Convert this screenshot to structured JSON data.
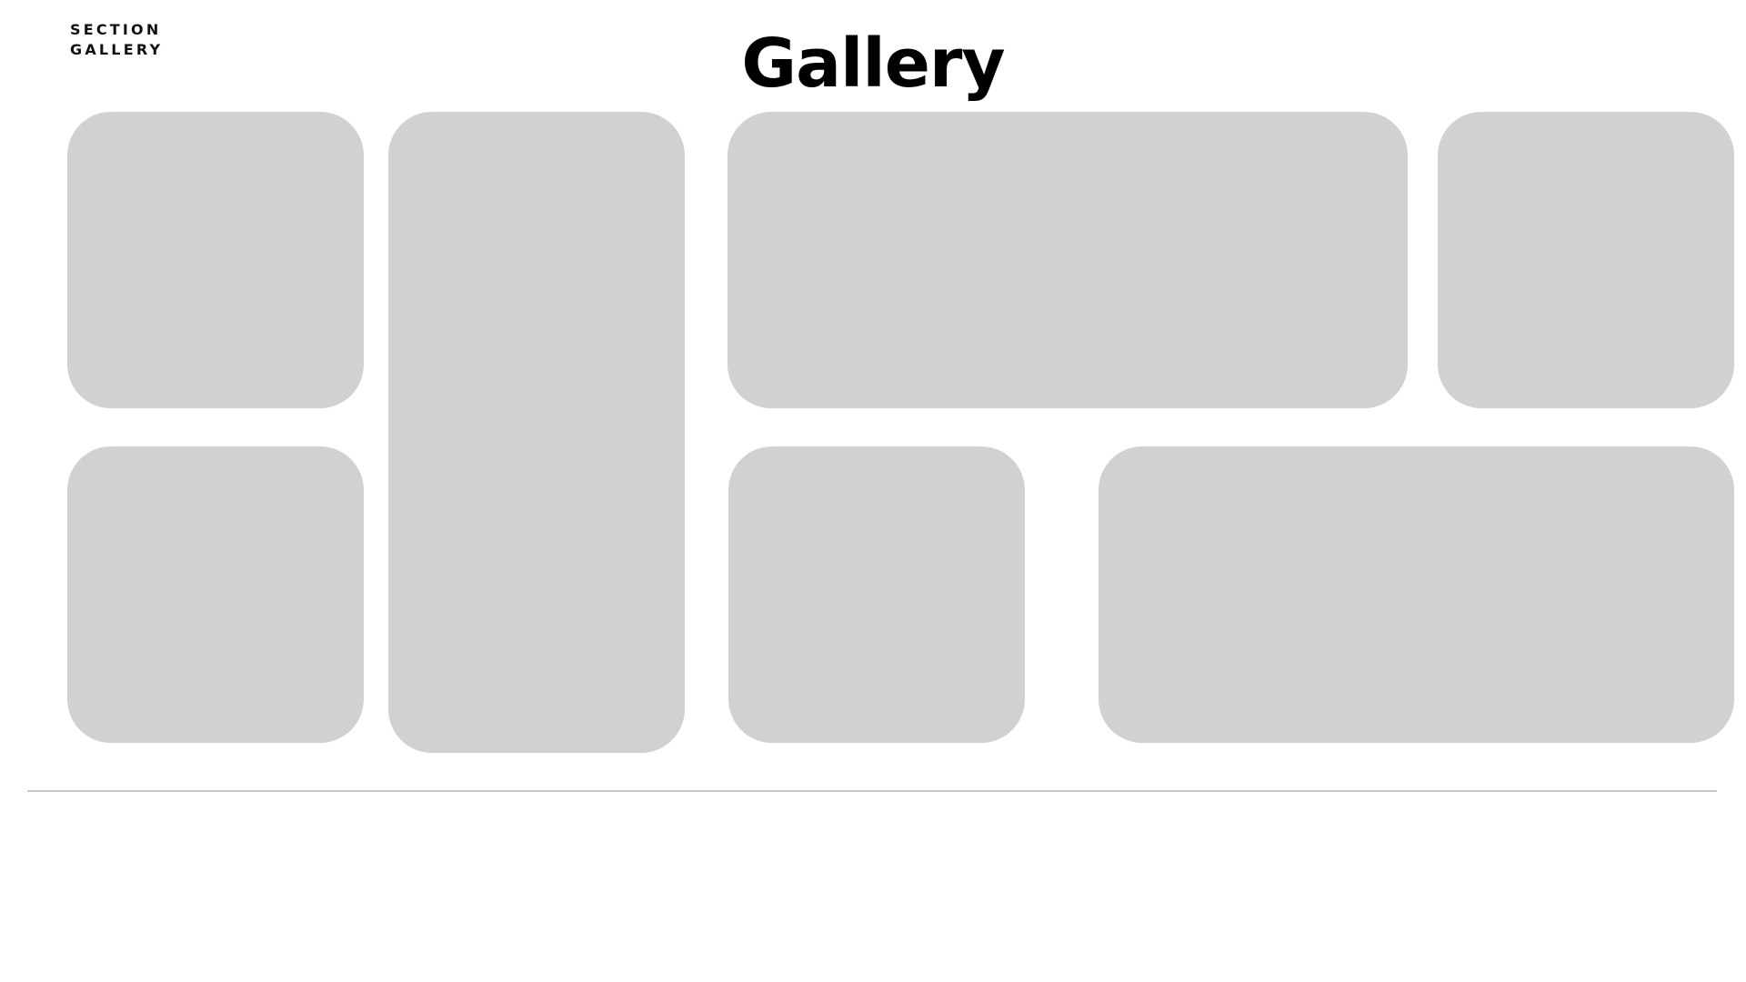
{
  "section": {
    "line1": "SECTION",
    "line2": "GALLERY"
  },
  "title": "Gallery",
  "colors": {
    "background": "#ffffff",
    "tile": "#d1d1d1",
    "divider": "#c8c8c8",
    "text": "#000000"
  }
}
